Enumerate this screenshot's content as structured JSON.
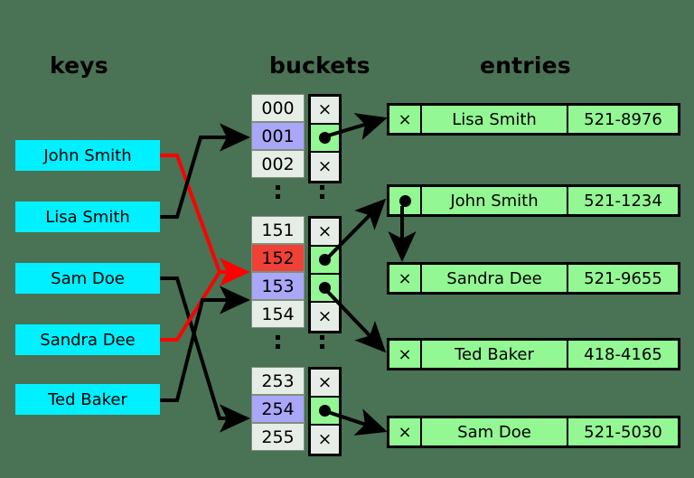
{
  "headers": {
    "keys": "keys",
    "buckets": "buckets",
    "entries": "entries"
  },
  "keys": [
    {
      "label": "John Smith",
      "maps_to_bucket": "152",
      "wire_color": "#ff0000"
    },
    {
      "label": "Lisa Smith",
      "maps_to_bucket": "001",
      "wire_color": "#000000"
    },
    {
      "label": "Sam Doe",
      "maps_to_bucket": "254",
      "wire_color": "#000000"
    },
    {
      "label": "Sandra Dee",
      "maps_to_bucket": "152",
      "wire_color": "#ff0000"
    },
    {
      "label": "Ted Baker",
      "maps_to_bucket": "153",
      "wire_color": "#000000"
    }
  ],
  "bucket_groups": [
    {
      "rows": [
        {
          "index": "000",
          "highlight": "none",
          "pointer": "empty",
          "symbol": "×"
        },
        {
          "index": "001",
          "highlight": "purple",
          "pointer": "filled",
          "symbol": "●",
          "points_to": "Lisa Smith"
        },
        {
          "index": "002",
          "highlight": "none",
          "pointer": "empty",
          "symbol": "×"
        }
      ]
    },
    {
      "rows": [
        {
          "index": "151",
          "highlight": "none",
          "pointer": "empty",
          "symbol": "×"
        },
        {
          "index": "152",
          "highlight": "red",
          "pointer": "filled",
          "symbol": "●",
          "points_to": "John Smith"
        },
        {
          "index": "153",
          "highlight": "purple",
          "pointer": "filled",
          "symbol": "●",
          "points_to": "Ted Baker"
        },
        {
          "index": "154",
          "highlight": "none",
          "pointer": "empty",
          "symbol": "×"
        }
      ]
    },
    {
      "rows": [
        {
          "index": "253",
          "highlight": "none",
          "pointer": "empty",
          "symbol": "×"
        },
        {
          "index": "254",
          "highlight": "purple",
          "pointer": "filled",
          "symbol": "●",
          "points_to": "Sam Doe"
        },
        {
          "index": "255",
          "highlight": "none",
          "pointer": "empty",
          "symbol": "×"
        }
      ]
    }
  ],
  "ellipsis_marker": "⋮",
  "entries": [
    {
      "link": "×",
      "link_kind": "null",
      "name": "Lisa Smith",
      "phone": "521-8976"
    },
    {
      "link": "●",
      "link_kind": "next",
      "name": "John Smith",
      "phone": "521-1234",
      "next_entry": "Sandra Dee"
    },
    {
      "link": "×",
      "link_kind": "null",
      "name": "Sandra Dee",
      "phone": "521-9655"
    },
    {
      "link": "×",
      "link_kind": "null",
      "name": "Ted Baker",
      "phone": "418-4165"
    },
    {
      "link": "×",
      "link_kind": "null",
      "name": "Sam Doe",
      "phone": "521-5030"
    }
  ],
  "colors": {
    "background": "#4a7254",
    "key_box": "#00f0ff",
    "entry_box": "#93f793",
    "bucket_cell": "#e6ede6",
    "highlight_purple": "#aaa6f8",
    "highlight_red": "#ef4136",
    "collision_wire": "#ff0000",
    "normal_wire": "#000000"
  }
}
